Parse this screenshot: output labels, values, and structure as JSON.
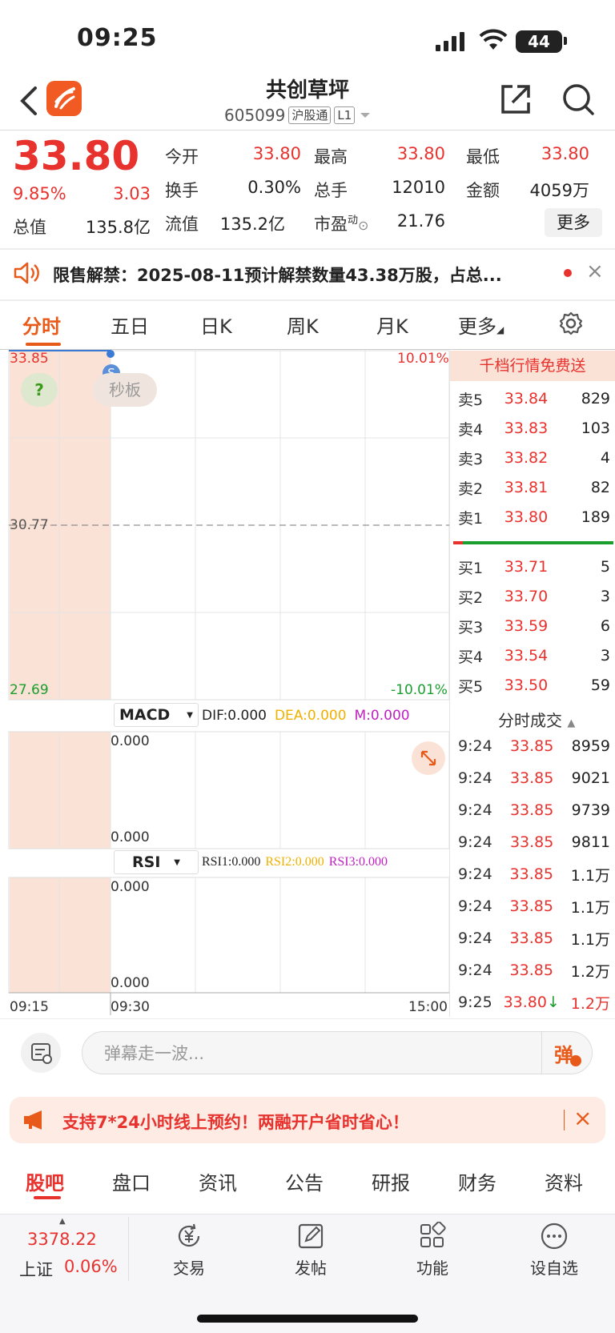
{
  "status_bar": {
    "time": "09:25",
    "battery": "44"
  },
  "header": {
    "title": "共创草坪",
    "code": "605099",
    "exchange_tag": "沪股通",
    "level_tag": "L1"
  },
  "quote": {
    "price": "33.80",
    "change_pct": "9.85%",
    "change_abs": "3.03",
    "rows": [
      [
        {
          "label": "今开",
          "value": "33.80",
          "color": "red"
        },
        {
          "label": "最高",
          "value": "33.80",
          "color": "red"
        },
        {
          "label": "最低",
          "value": "33.80",
          "color": "red"
        }
      ],
      [
        {
          "label": "换手",
          "value": "0.30%",
          "color": "dark"
        },
        {
          "label": "总手",
          "value": "12010",
          "color": "dark"
        },
        {
          "label": "金额",
          "value": "4059万",
          "color": "dark"
        }
      ],
      [
        {
          "label": "总值",
          "value": "135.8亿",
          "color": "dark"
        },
        {
          "label": "流值",
          "value": "135.2亿",
          "color": "dark"
        },
        {
          "label": "市盈",
          "sup": "动",
          "value": "21.76",
          "color": "dark"
        }
      ]
    ],
    "more_label": "更多"
  },
  "notice": {
    "text": "限售解禁：2025-08-11预计解禁数量43.38万股，占总..."
  },
  "chart_tabs": [
    "分时",
    "五日",
    "日K",
    "周K",
    "月K",
    "更多"
  ],
  "intraday": {
    "y_top": "33.85",
    "y_mid": "30.77",
    "y_bottom": "27.69",
    "pct_top": "10.01%",
    "pct_bottom": "-10.01%",
    "help_mark": "?",
    "badge_label": "秒板",
    "marker": "S",
    "macd": {
      "name": "MACD",
      "dif": "DIF:0.000",
      "dea": "DEA:0.000",
      "m": "M:0.000",
      "top": "0.000",
      "bottom": "0.000"
    },
    "rsi": {
      "name": "RSI",
      "rsi1": "RSI1:0.000",
      "rsi2": "RSI2:0.000",
      "rsi3": "RSI3:0.000",
      "top": "0.000",
      "bottom": "0.000"
    },
    "x_labels": [
      "09:15",
      "09:30",
      "15:00"
    ]
  },
  "order_book": {
    "banner": "千档行情免费送",
    "asks": [
      {
        "name": "卖5",
        "price": "33.84",
        "vol": "829"
      },
      {
        "name": "卖4",
        "price": "33.83",
        "vol": "103"
      },
      {
        "name": "卖3",
        "price": "33.82",
        "vol": "4"
      },
      {
        "name": "卖2",
        "price": "33.81",
        "vol": "82"
      },
      {
        "name": "卖1",
        "price": "33.80",
        "vol": "189"
      }
    ],
    "bids": [
      {
        "name": "买1",
        "price": "33.71",
        "vol": "5"
      },
      {
        "name": "买2",
        "price": "33.70",
        "vol": "3"
      },
      {
        "name": "买3",
        "price": "33.59",
        "vol": "6"
      },
      {
        "name": "买4",
        "price": "33.54",
        "vol": "3"
      },
      {
        "name": "买5",
        "price": "33.50",
        "vol": "59"
      }
    ],
    "trades_title": "分时成交",
    "trades": [
      {
        "t": "9:24",
        "p": "33.85",
        "v": "8959"
      },
      {
        "t": "9:24",
        "p": "33.85",
        "v": "9021"
      },
      {
        "t": "9:24",
        "p": "33.85",
        "v": "9739"
      },
      {
        "t": "9:24",
        "p": "33.85",
        "v": "9811"
      },
      {
        "t": "9:24",
        "p": "33.85",
        "v": "1.1万"
      },
      {
        "t": "9:24",
        "p": "33.85",
        "v": "1.1万"
      },
      {
        "t": "9:24",
        "p": "33.85",
        "v": "1.1万"
      },
      {
        "t": "9:24",
        "p": "33.85",
        "v": "1.2万"
      },
      {
        "t": "9:25",
        "p": "33.80",
        "v": "1.2万",
        "arrow": "↓"
      }
    ]
  },
  "barrage": {
    "placeholder": "弹幕走一波...",
    "button": "弹"
  },
  "promo": {
    "text": "支持7*24小时线上预约！两融开户省时省心！"
  },
  "bottom_tabs": [
    "股吧",
    "盘口",
    "资讯",
    "公告",
    "研报",
    "财务",
    "资料"
  ],
  "nav": {
    "index_value": "3378.22",
    "index_name": "上证",
    "index_change": "0.06%",
    "items": [
      {
        "label": "交易",
        "icon": "yen-refresh-icon"
      },
      {
        "label": "发帖",
        "icon": "edit-icon"
      },
      {
        "label": "功能",
        "icon": "grid-icon"
      },
      {
        "label": "设自选",
        "icon": "more-dots-icon"
      }
    ]
  }
}
